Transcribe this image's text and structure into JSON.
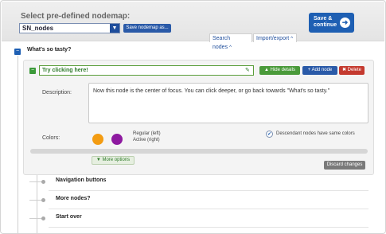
{
  "header": {
    "select_label": "Select pre-defined nodemap:",
    "selected_nodemap": "SN_nodes",
    "save_nodemap_label": "Save nodemap as...",
    "save_continue_label": "Save & continue",
    "tabs": [
      {
        "label": "Search nodes"
      },
      {
        "label": "Import/export"
      }
    ]
  },
  "tree": {
    "root_label": "What's so tasty?",
    "focused_node": {
      "title": "Try clicking here!",
      "hide_details_label": "Hide details",
      "add_node_label": "Add node",
      "delete_label": "Delete",
      "description_label": "Description:",
      "description": "Now this node is the center of focus. You can click deeper, or go back towards \"What's so tasty.\"",
      "colors_label": "Colors:",
      "colors_legend_regular": "Regular (left)",
      "colors_legend_active": "Active (right)",
      "regular_color": "#f39c12",
      "active_color": "#8e1aa0",
      "descendant_label": "Descendant nodes have same colors",
      "descendant_checked": true,
      "more_options_label": "More options",
      "discard_label": "Discard changes"
    },
    "children": [
      {
        "label": "Navigation buttons"
      },
      {
        "label": "More nodes?"
      },
      {
        "label": "Start over"
      }
    ]
  }
}
